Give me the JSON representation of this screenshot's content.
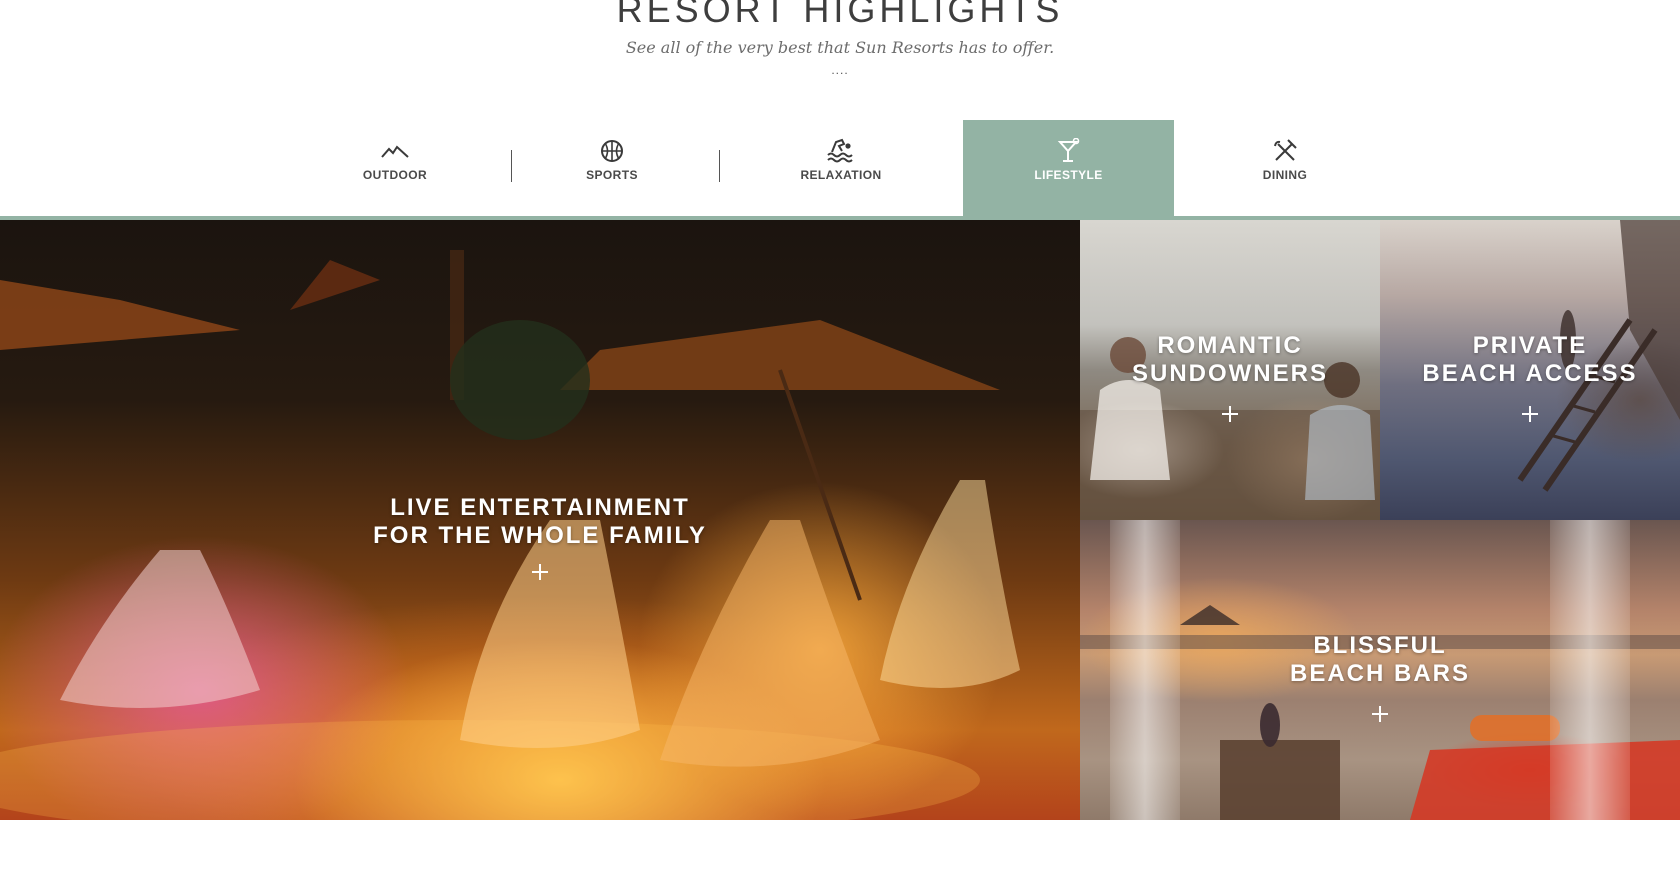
{
  "header": {
    "title": "RESORT HIGHLIGHTS",
    "subtitle": "See all of the very best that Sun Resorts has to offer.",
    "divider": "...."
  },
  "tabs": [
    {
      "label": "OUTDOOR",
      "icon": "mountain-icon",
      "active": false
    },
    {
      "label": "SPORTS",
      "icon": "basketball-icon",
      "active": false
    },
    {
      "label": "RELAXATION",
      "icon": "swimming-icon",
      "active": false
    },
    {
      "label": "LIFESTYLE",
      "icon": "cocktail-icon",
      "active": true
    },
    {
      "label": "DINING",
      "icon": "fork-knife-icon",
      "active": false
    }
  ],
  "tiles": [
    {
      "line1": "LIVE ENTERTAINMENT",
      "line2": "FOR THE WHOLE FAMILY",
      "action": "+"
    },
    {
      "line1": "ROMANTIC",
      "line2": "SUNDOWNERS",
      "action": "+"
    },
    {
      "line1": "PRIVATE",
      "line2": "BEACH ACCESS",
      "action": "+"
    },
    {
      "line1": "BLISSFUL",
      "line2": "BEACH BARS",
      "action": "+"
    }
  ],
  "colors": {
    "accent": "#93b3a4",
    "title": "#3e3e3e",
    "tab_label": "#4a4a4a"
  }
}
